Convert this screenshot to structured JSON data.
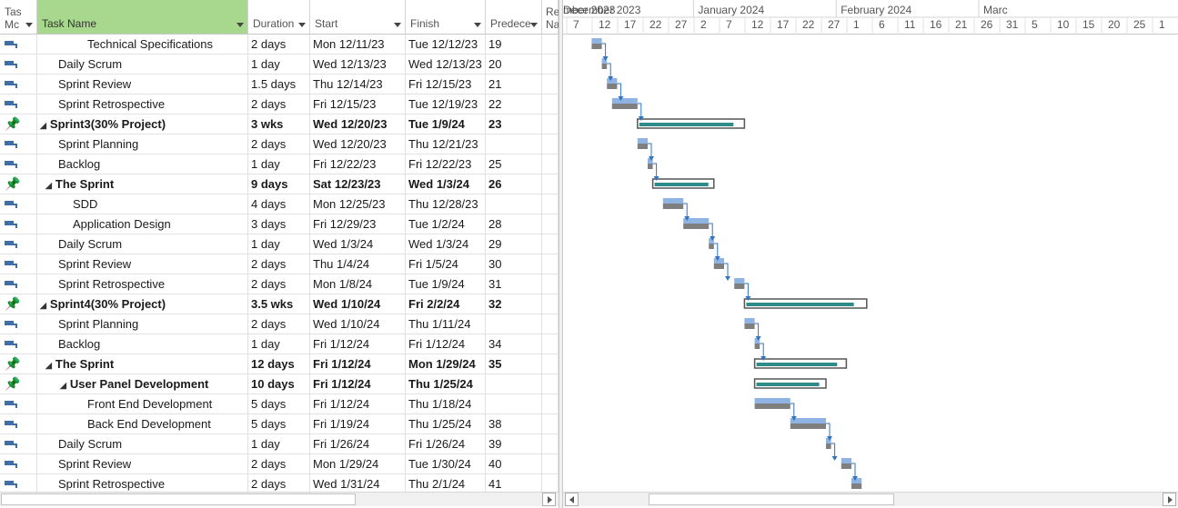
{
  "columns": {
    "indicator_line1": "Tas",
    "indicator_line2": "Mc",
    "task_name": "Task Name",
    "duration": "Duration",
    "start": "Start",
    "finish": "Finish",
    "predecessors": "Predece",
    "resource_line1": "Re",
    "resource_line2": "Na"
  },
  "timescale": {
    "months": [
      "mber 2023",
      "December 2023",
      "January 2024",
      "February 2024",
      "Marc"
    ],
    "days": [
      "7",
      "12",
      "17",
      "22",
      "27",
      "2",
      "7",
      "12",
      "17",
      "22",
      "27",
      "1",
      "6",
      "11",
      "16",
      "21",
      "26",
      "31",
      "5",
      "10",
      "15",
      "20",
      "25",
      "1"
    ]
  },
  "tasks": [
    {
      "mode": "auto",
      "level": 3,
      "summary": false,
      "name": "Technical Specifications",
      "duration": "2 days",
      "start": "Mon 12/11/23",
      "finish": "Tue 12/12/23",
      "pred": "19"
    },
    {
      "mode": "auto",
      "level": 1,
      "summary": false,
      "name": "Daily Scrum",
      "duration": "1 day",
      "start": "Wed 12/13/23",
      "finish": "Wed 12/13/23",
      "pred": "20"
    },
    {
      "mode": "auto",
      "level": 1,
      "summary": false,
      "name": "Sprint Review",
      "duration": "1.5 days",
      "start": "Thu 12/14/23",
      "finish": "Fri 12/15/23",
      "pred": "21"
    },
    {
      "mode": "auto",
      "level": 1,
      "summary": false,
      "name": "Sprint Retrospective",
      "duration": "2 days",
      "start": "Fri 12/15/23",
      "finish": "Tue 12/19/23",
      "pred": "22"
    },
    {
      "mode": "manual",
      "level": 0,
      "summary": true,
      "name": "Sprint3(30% Project)",
      "duration": "3 wks",
      "start": "Wed 12/20/23",
      "finish": "Tue 1/9/24",
      "pred": "23"
    },
    {
      "mode": "auto",
      "level": 1,
      "summary": false,
      "name": "Sprint Planning",
      "duration": "2 days",
      "start": "Wed 12/20/23",
      "finish": "Thu 12/21/23",
      "pred": ""
    },
    {
      "mode": "auto",
      "level": 1,
      "summary": false,
      "name": "Backlog",
      "duration": "1 day",
      "start": "Fri 12/22/23",
      "finish": "Fri 12/22/23",
      "pred": "25"
    },
    {
      "mode": "manual",
      "level": 1,
      "summary": true,
      "name": "The Sprint",
      "duration": "9 days",
      "start": "Sat 12/23/23",
      "finish": "Wed 1/3/24",
      "pred": "26"
    },
    {
      "mode": "auto",
      "level": 2,
      "summary": false,
      "name": "SDD",
      "duration": "4 days",
      "start": "Mon 12/25/23",
      "finish": "Thu 12/28/23",
      "pred": ""
    },
    {
      "mode": "auto",
      "level": 2,
      "summary": false,
      "name": "Application Design",
      "duration": "3 days",
      "start": "Fri 12/29/23",
      "finish": "Tue 1/2/24",
      "pred": "28"
    },
    {
      "mode": "auto",
      "level": 1,
      "summary": false,
      "name": "Daily Scrum",
      "duration": "1 day",
      "start": "Wed 1/3/24",
      "finish": "Wed 1/3/24",
      "pred": "29"
    },
    {
      "mode": "auto",
      "level": 1,
      "summary": false,
      "name": "Sprint Review",
      "duration": "2 days",
      "start": "Thu 1/4/24",
      "finish": "Fri 1/5/24",
      "pred": "30"
    },
    {
      "mode": "auto",
      "level": 1,
      "summary": false,
      "name": "Sprint Retrospective",
      "duration": "2 days",
      "start": "Mon 1/8/24",
      "finish": "Tue 1/9/24",
      "pred": "31"
    },
    {
      "mode": "manual",
      "level": 0,
      "summary": true,
      "name": "Sprint4(30% Project)",
      "duration": "3.5 wks",
      "start": "Wed 1/10/24",
      "finish": "Fri 2/2/24",
      "pred": "32"
    },
    {
      "mode": "auto",
      "level": 1,
      "summary": false,
      "name": "Sprint Planning",
      "duration": "2 days",
      "start": "Wed 1/10/24",
      "finish": "Thu 1/11/24",
      "pred": ""
    },
    {
      "mode": "auto",
      "level": 1,
      "summary": false,
      "name": "Backlog",
      "duration": "1 day",
      "start": "Fri 1/12/24",
      "finish": "Fri 1/12/24",
      "pred": "34"
    },
    {
      "mode": "manual",
      "level": 1,
      "summary": true,
      "name": "The Sprint",
      "duration": "12 days",
      "start": "Fri 1/12/24",
      "finish": "Mon 1/29/24",
      "pred": "35"
    },
    {
      "mode": "manual",
      "level": 2,
      "summary": true,
      "name": "User Panel Development",
      "duration": "10 days",
      "start": "Fri 1/12/24",
      "finish": "Thu 1/25/24",
      "pred": ""
    },
    {
      "mode": "auto",
      "level": 3,
      "summary": false,
      "name": "Front End Development",
      "duration": "5 days",
      "start": "Fri 1/12/24",
      "finish": "Thu 1/18/24",
      "pred": ""
    },
    {
      "mode": "auto",
      "level": 3,
      "summary": false,
      "name": "Back End Development",
      "duration": "5 days",
      "start": "Fri 1/19/24",
      "finish": "Thu 1/25/24",
      "pred": "38"
    },
    {
      "mode": "auto",
      "level": 1,
      "summary": false,
      "name": "Daily Scrum",
      "duration": "1 day",
      "start": "Fri 1/26/24",
      "finish": "Fri 1/26/24",
      "pred": "39"
    },
    {
      "mode": "auto",
      "level": 1,
      "summary": false,
      "name": "Sprint Review",
      "duration": "2 days",
      "start": "Mon 1/29/24",
      "finish": "Tue 1/30/24",
      "pred": "40"
    },
    {
      "mode": "auto",
      "level": 1,
      "summary": false,
      "name": "Sprint Retrospective",
      "duration": "2 days",
      "start": "Wed 1/31/24",
      "finish": "Thu 2/1/24",
      "pred": "41"
    }
  ],
  "colors": {
    "header_selected": "#a7d88d",
    "task_bar_top": "#8fb4e3",
    "task_bar_bottom": "#7f7f7f",
    "summary_fill": "#2e8b8b",
    "link": "#2f75c4"
  }
}
